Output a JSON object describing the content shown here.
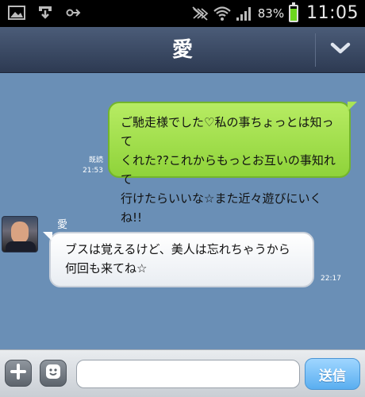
{
  "status_bar": {
    "battery_percent": "83%",
    "battery_level": 0.83,
    "time": "11:05",
    "icons": [
      "gallery-icon",
      "download-icon",
      "link-icon",
      "mute-icon",
      "wifi-icon",
      "signal-icon",
      "battery-icon"
    ]
  },
  "header": {
    "title": "愛",
    "menu_icon": "chevron-down-icon"
  },
  "messages": [
    {
      "direction": "sent",
      "lines": [
        "ご馳走様でした♡私の事ちょっとは知って",
        "くれた??これからもっとお互いの事知れて",
        "行けたらいいな☆また近々遊びにいくね!!"
      ],
      "read_label": "既読",
      "time": "21:53"
    },
    {
      "direction": "received",
      "sender": "愛",
      "lines": [
        "ブスは覚えるけど、美人は忘れちゃうから",
        "何回も来てね☆"
      ],
      "time": "22:17"
    }
  ],
  "input_bar": {
    "plus_icon": "plus-icon",
    "emoji_icon": "emoji-icon",
    "input_value": "",
    "send_label": "送信"
  },
  "colors": {
    "chat_bg": "#6a8fb6",
    "sent_bubble": "#9ddd45",
    "header": "#3a4862",
    "send_button": "#6db8f5"
  }
}
